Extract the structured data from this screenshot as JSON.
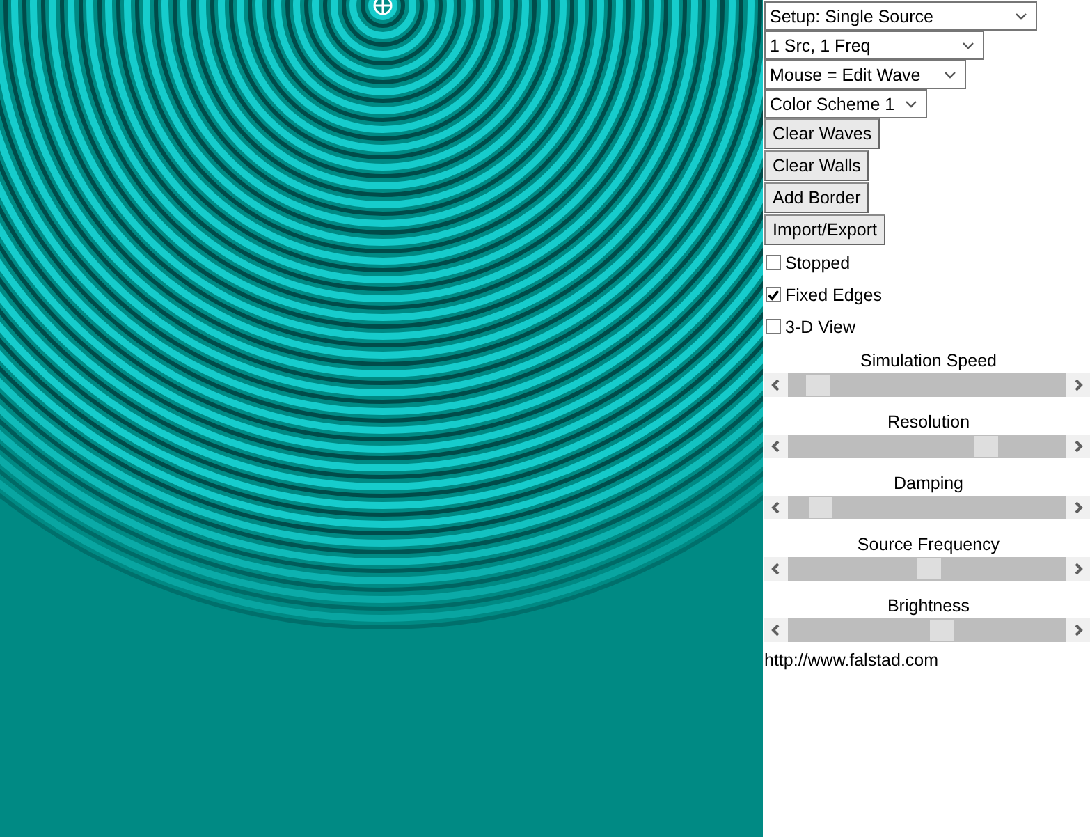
{
  "dropdowns": [
    {
      "value": "Setup: Single Source"
    },
    {
      "value": "1 Src, 1 Freq"
    },
    {
      "value": "Mouse = Edit Wave"
    },
    {
      "value": "Color Scheme 1"
    }
  ],
  "buttons": [
    "Clear Waves",
    "Clear Walls",
    "Add Border",
    "Import/Export"
  ],
  "checkboxes": [
    {
      "label": "Stopped",
      "checked": false
    },
    {
      "label": "Fixed Edges",
      "checked": true
    },
    {
      "label": "3-D View",
      "checked": false
    }
  ],
  "sliders": [
    {
      "label": "Simulation Speed",
      "level": 0.07
    },
    {
      "label": "Resolution",
      "level": 0.73
    },
    {
      "label": "Damping",
      "level": 0.08
    },
    {
      "label": "Source Frequency",
      "level": 0.51
    },
    {
      "label": "Brightness",
      "level": 0.56
    }
  ],
  "link": "http://www.falstad.com"
}
